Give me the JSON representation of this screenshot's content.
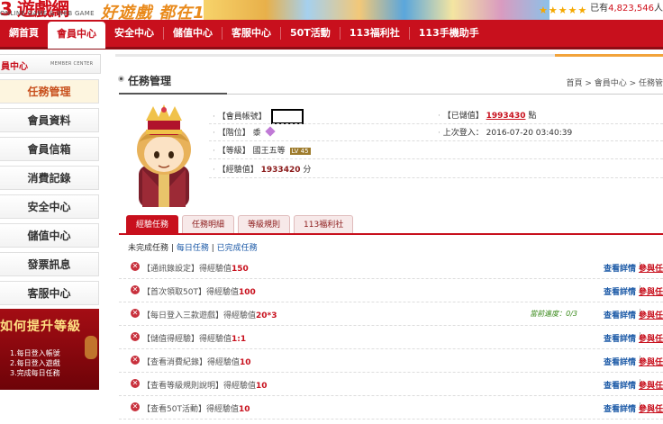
{
  "banner": {
    "logo_mark": "3 遊戲網",
    "logo_sub": "ONLINE GAME & WEB GAME",
    "slogan": "好遊戲 都在113",
    "member_count_prefix": "已有",
    "member_count": "4,823,546",
    "member_count_suffix": "人"
  },
  "nav": {
    "items": [
      "網首頁",
      "會員中心",
      "安全中心",
      "儲值中心",
      "客服中心",
      "50T活動",
      "113福利社",
      "113手機助手"
    ],
    "active_index": 1
  },
  "sidebar": {
    "title": "員中心",
    "title_en": "MEMBER CENTER",
    "items": [
      "任務管理",
      "會員資料",
      "會員信箱",
      "消費記錄",
      "安全中心",
      "儲值中心",
      "發票訊息",
      "客服中心"
    ],
    "active_index": 0
  },
  "promo": {
    "title": "如何提升等級",
    "lines": [
      "1.每日登入帳號",
      "2.每日登入遊戲",
      "3.完成每日任務"
    ]
  },
  "page": {
    "title": "任務管理",
    "breadcrumb": "首頁 > 會員中心 > 任務管"
  },
  "profile": {
    "account_label": "【會員帳號】",
    "rank_label": "【階位】",
    "rank_value": "黍",
    "level_label": "【等級】",
    "level_value": "國王五等",
    "level_badge": "LV 45",
    "exp_label": "【經驗值】",
    "exp_value": "1933420",
    "exp_unit": "分",
    "stored_label": "【已儲值】",
    "stored_value": "1993430",
    "stored_unit": "點",
    "last_login_label": "上次登入：",
    "last_login_value": "2016-07-20 03:40:39"
  },
  "tabs": [
    "經驗任務",
    "任務明細",
    "等級規則",
    "113福利社"
  ],
  "subtabs": {
    "current": "未完成任務",
    "sep": "|",
    "daily": "每日任務",
    "done": "已完成任務"
  },
  "tasks": [
    {
      "name": "【通訊錄設定】得經驗值",
      "points": "150",
      "progress": ""
    },
    {
      "name": "【首次領取50T】得經驗值",
      "points": "100",
      "progress": ""
    },
    {
      "name": "【每日登入三款遊戲】得經驗值",
      "points": "20*3",
      "progress": "當前進度：0/3"
    },
    {
      "name": "【儲值得經驗】得經驗值",
      "points": "1:1",
      "progress": ""
    },
    {
      "name": "【查看消費紀錄】得經驗值",
      "points": "10",
      "progress": ""
    },
    {
      "name": "【查看等級規則說明】得經驗值",
      "points": "10",
      "progress": ""
    },
    {
      "name": "【查看50T活動】得經驗值",
      "points": "10",
      "progress": ""
    }
  ],
  "task_actions": {
    "detail": "查看詳情",
    "pipe": "|",
    "join": "參與任"
  },
  "colors": {
    "brand_red": "#c8101d",
    "link_blue": "#1c5aa7",
    "accent_orange": "#f2a33a"
  }
}
